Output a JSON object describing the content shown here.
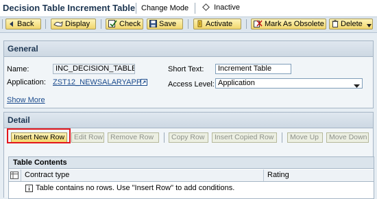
{
  "header": {
    "title": "Decision Table Increment Table",
    "mode": "Change Mode",
    "status": "Inactive"
  },
  "toolbar": {
    "back": "Back",
    "display": "Display",
    "check": "Check",
    "save": "Save",
    "activate": "Activate",
    "mark_obsolete": "Mark As Obsolete",
    "delete": "Delete",
    "icons": [
      "back-icon",
      "display-icon",
      "check-icon",
      "save-icon",
      "activate-icon",
      "mark-obsolete-icon",
      "delete-icon",
      "dropdown-arrow-icon"
    ]
  },
  "general": {
    "heading": "General",
    "name_label": "Name:",
    "name_value": "INC_DECISION_TABLE",
    "application_label": "Application:",
    "application_value": "ZST12_NEWSALARYAPP",
    "short_text_label": "Short Text:",
    "short_text_value": "Increment Table",
    "access_level_label": "Access Level:",
    "access_level_value": "Application",
    "show_more": "Show More"
  },
  "detail": {
    "heading": "Detail",
    "buttons": {
      "insert_new_row": "Insert New Row",
      "edit_row": "Edit Row",
      "remove_row": "Remove Row",
      "copy_row": "Copy Row",
      "insert_copied_row": "Insert Copied Row",
      "move_up": "Move Up",
      "move_down": "Move Down"
    },
    "highlight_color": "#e3161c"
  },
  "table": {
    "title": "Table Contents",
    "columns": [
      "Contract type",
      "Rating"
    ],
    "empty_message": "Table contains no rows. Use \"Insert Row\" to add conditions."
  },
  "colors": {
    "button_yellow": "#f6df82",
    "title_blue": "#1c3551",
    "link_blue": "#1a4a8c"
  }
}
